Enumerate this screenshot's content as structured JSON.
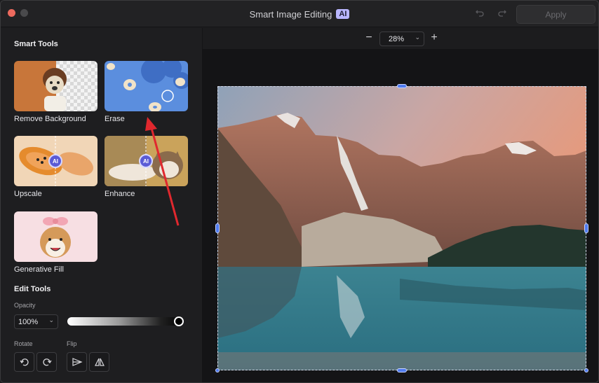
{
  "window": {
    "title": "Smart Image Editing",
    "title_badge": "AI",
    "apply_label": "Apply"
  },
  "sidebar": {
    "smart_tools_title": "Smart Tools",
    "tools": [
      {
        "label": "Remove Background"
      },
      {
        "label": "Erase"
      },
      {
        "label": "Upscale",
        "badge": "AI"
      },
      {
        "label": "Enhance",
        "badge": "AI"
      },
      {
        "label": "Generative Fill"
      }
    ],
    "edit_tools_title": "Edit Tools",
    "opacity": {
      "label": "Opacity",
      "value": "100%",
      "level": 1.0
    },
    "rotate_label": "Rotate",
    "flip_label": "Flip"
  },
  "canvas": {
    "zoom_value": "28%"
  },
  "colors": {
    "accent": "#4f7bf0",
    "apply_disabled": "#6a6a6e",
    "annotation_arrow": "#e0282e"
  },
  "icons": [
    "undo-icon",
    "redo-icon",
    "rotate-left-icon",
    "rotate-right-icon",
    "flip-horizontal-icon",
    "flip-vertical-icon",
    "chevron-down-icon"
  ]
}
